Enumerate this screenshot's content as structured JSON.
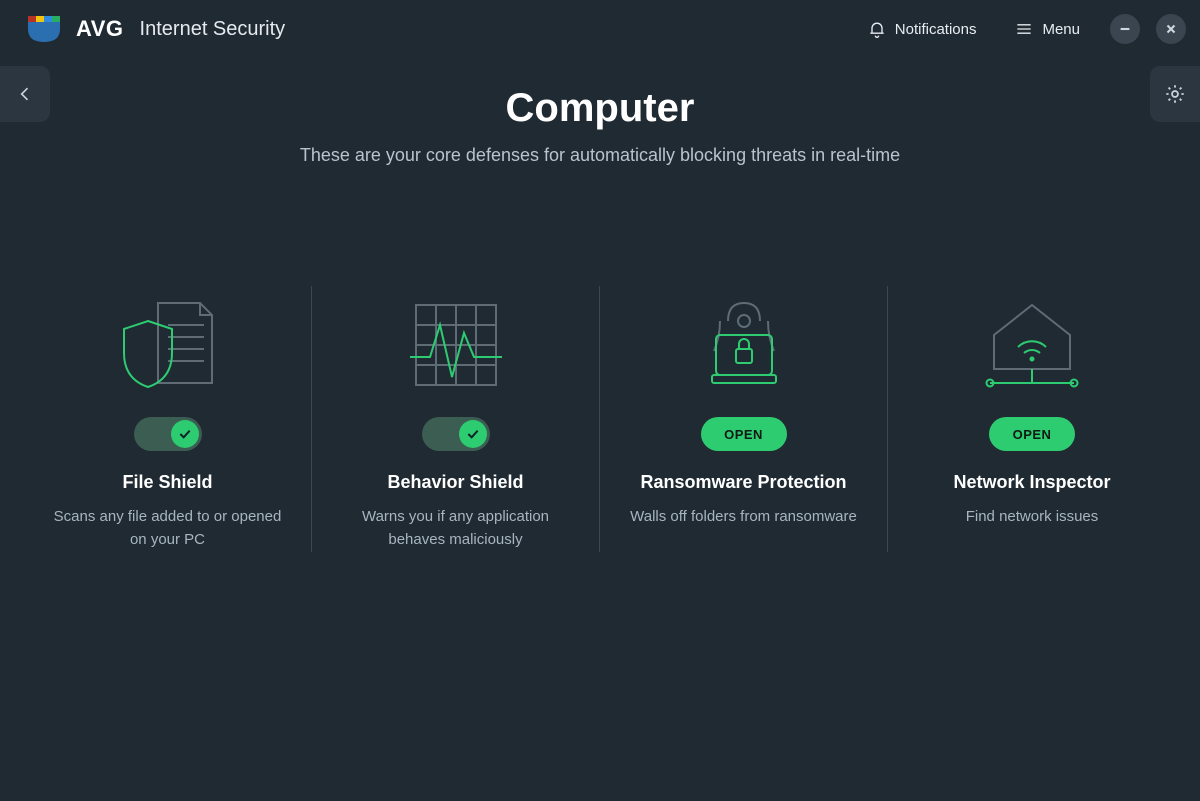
{
  "header": {
    "brand": "AVG",
    "product": "Internet Security",
    "notifications_label": "Notifications",
    "menu_label": "Menu"
  },
  "page": {
    "title": "Computer",
    "subtitle": "These are your core defenses for automatically blocking threats in real-time"
  },
  "cards": [
    {
      "id": "file-shield",
      "control": "toggle",
      "enabled": true,
      "title": "File Shield",
      "desc": "Scans any file added to or opened on your PC"
    },
    {
      "id": "behavior-shield",
      "control": "toggle",
      "enabled": true,
      "title": "Behavior Shield",
      "desc": "Warns you if any application behaves maliciously"
    },
    {
      "id": "ransomware-protection",
      "control": "open",
      "open_label": "OPEN",
      "title": "Ransomware Protection",
      "desc": "Walls off folders from ransomware"
    },
    {
      "id": "network-inspector",
      "control": "open",
      "open_label": "OPEN",
      "title": "Network Inspector",
      "desc": "Find network issues"
    }
  ],
  "colors": {
    "bg": "#1f2a33",
    "accent": "#2ecc71",
    "muted": "#5f6b75"
  }
}
